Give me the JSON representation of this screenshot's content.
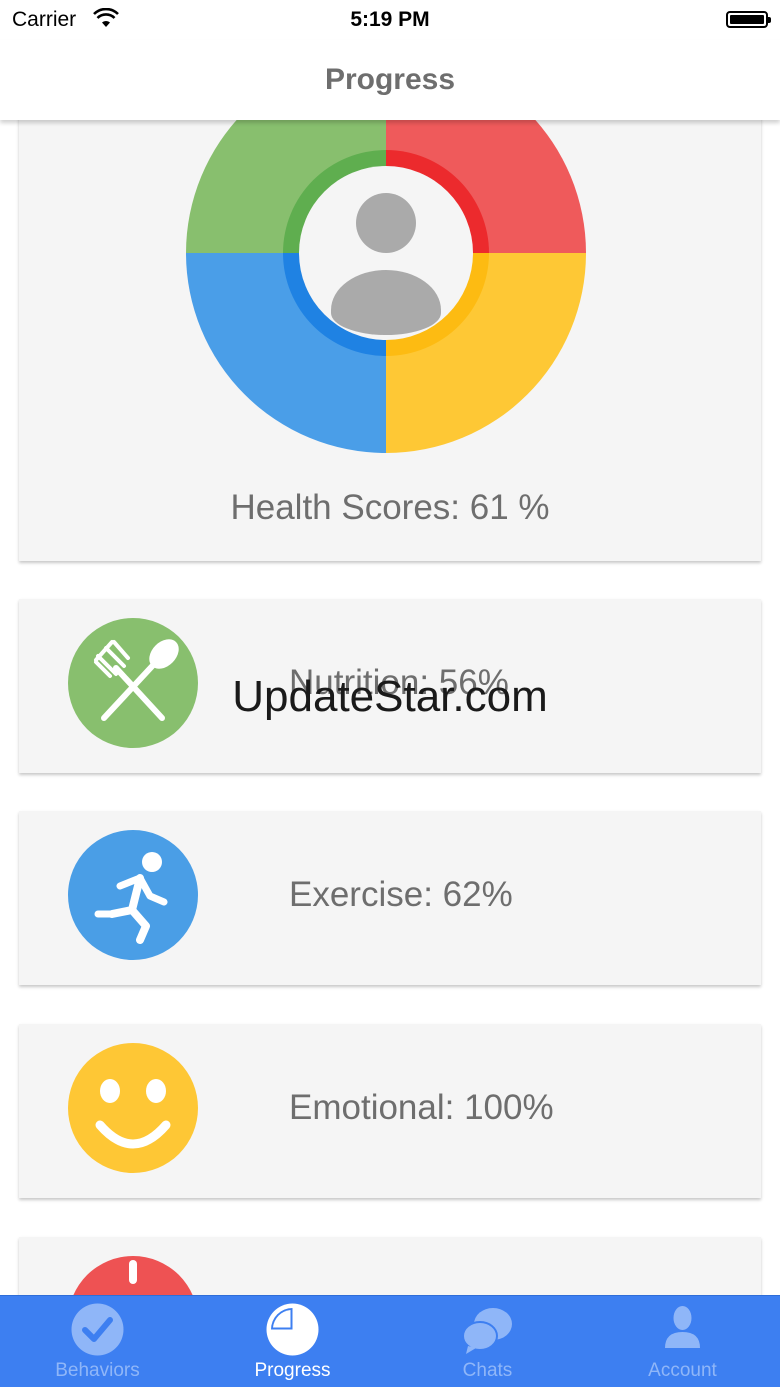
{
  "status_bar": {
    "carrier": "Carrier",
    "time": "5:19 PM"
  },
  "nav": {
    "title": "Progress"
  },
  "score": {
    "label": "Health Scores: 61 %",
    "value_percent": 61
  },
  "metrics": [
    {
      "label": "Nutrition: 56%",
      "value_percent": 56,
      "color": "#88bf6e",
      "icon": "fork-spoon-icon"
    },
    {
      "label": "Exercise: 62%",
      "value_percent": 62,
      "color": "#4a9ee6",
      "icon": "running-person-icon"
    },
    {
      "label": "Emotional: 100%",
      "value_percent": 100,
      "color": "#fec735",
      "icon": "smiley-face-icon"
    },
    {
      "label": "",
      "color": "#ee5253",
      "icon": "alert-icon"
    }
  ],
  "watermark": "UpdateStar.com",
  "tabs": [
    {
      "label": "Behaviors",
      "icon": "checkmark-circle-icon",
      "active": false
    },
    {
      "label": "Progress",
      "icon": "pie-chart-icon",
      "active": true
    },
    {
      "label": "Chats",
      "icon": "chat-bubbles-icon",
      "active": false
    },
    {
      "label": "Account",
      "icon": "person-icon",
      "active": false
    }
  ],
  "colors": {
    "tab_bar": "#3d7ff1",
    "nutrition": "#88bf6e",
    "exercise": "#4a9ee6",
    "emotional": "#fec735",
    "alert": "#ee5253"
  }
}
